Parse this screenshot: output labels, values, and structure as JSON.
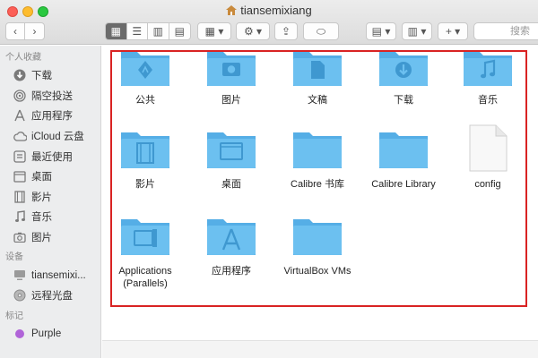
{
  "window": {
    "title": "tiansemixiang"
  },
  "toolbar": {
    "search_placeholder": "搜索"
  },
  "sidebar": {
    "favorites_title": "个人收藏",
    "favorites": [
      {
        "label": "下载",
        "icon": "download-icon"
      },
      {
        "label": "隔空投送",
        "icon": "airdrop-icon"
      },
      {
        "label": "应用程序",
        "icon": "applications-icon"
      },
      {
        "label": "iCloud 云盘",
        "icon": "cloud-icon"
      },
      {
        "label": "最近使用",
        "icon": "clock-icon"
      },
      {
        "label": "桌面",
        "icon": "desktop-icon"
      },
      {
        "label": "影片",
        "icon": "film-icon"
      },
      {
        "label": "音乐",
        "icon": "music-icon"
      },
      {
        "label": "图片",
        "icon": "camera-icon"
      }
    ],
    "devices_title": "设备",
    "devices": [
      {
        "label": "tiansemixi...",
        "icon": "computer-icon"
      },
      {
        "label": "远程光盘",
        "icon": "disc-icon"
      }
    ],
    "tags_title": "标记",
    "tags": [
      {
        "label": "Purple",
        "color": "#b064d8"
      }
    ]
  },
  "files": [
    {
      "label": "公共",
      "icon": "public-folder-icon"
    },
    {
      "label": "图片",
      "icon": "pictures-folder-icon"
    },
    {
      "label": "文稿",
      "icon": "documents-folder-icon"
    },
    {
      "label": "下载",
      "icon": "downloads-folder-icon"
    },
    {
      "label": "音乐",
      "icon": "music-folder-icon"
    },
    {
      "label": "影片",
      "icon": "movies-folder-icon"
    },
    {
      "label": "桌面",
      "icon": "desktop-folder-icon"
    },
    {
      "label": "Calibre 书库",
      "icon": "folder-icon"
    },
    {
      "label": "Calibre Library",
      "icon": "folder-icon"
    },
    {
      "label": "config",
      "icon": "document-file-icon"
    },
    {
      "label": "Applications\n(Parallels)",
      "icon": "parallels-folder-icon"
    },
    {
      "label": "应用程序",
      "icon": "applications-folder-icon"
    },
    {
      "label": "VirtualBox VMs",
      "icon": "folder-icon"
    }
  ],
  "colors": {
    "folder": "#6cc0f0",
    "folder_back": "#55aee6",
    "highlight": "#d92323"
  }
}
